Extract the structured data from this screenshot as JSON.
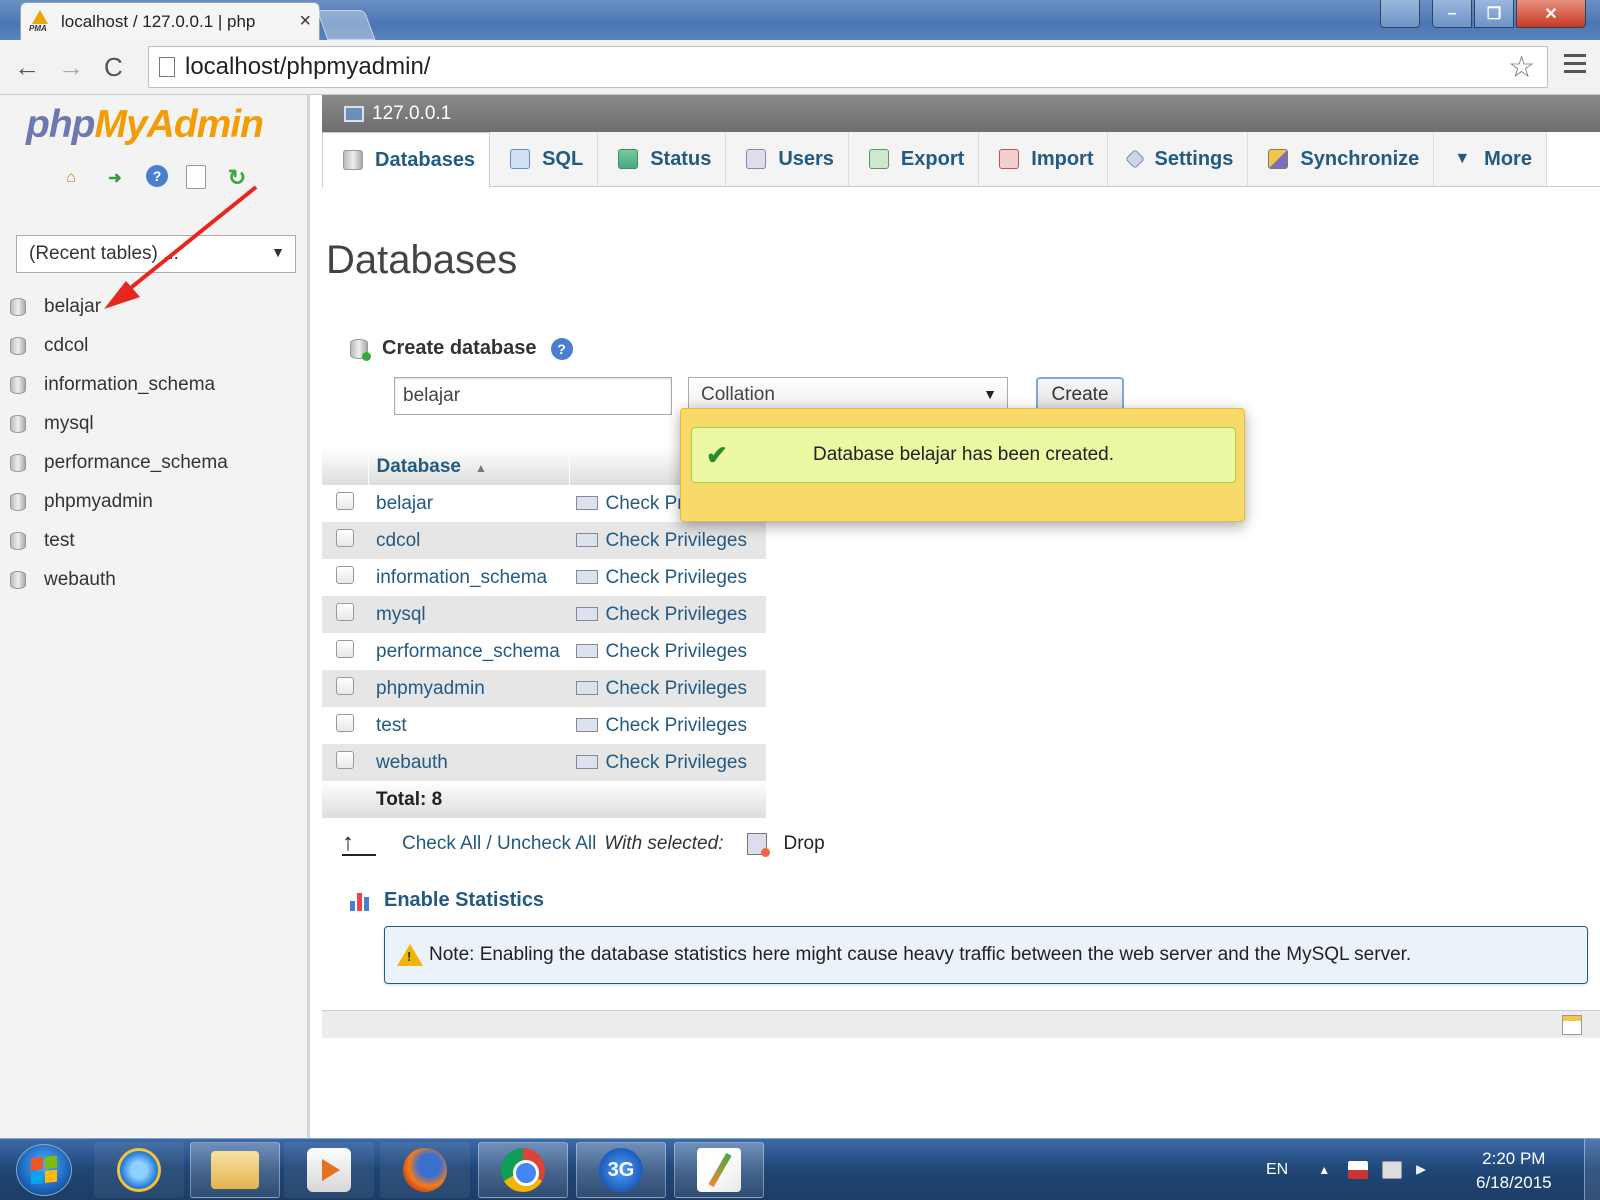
{
  "browser": {
    "tab_title": "localhost / 127.0.0.1 | php",
    "tab_close": "×",
    "url": "localhost/phpmyadmin/",
    "nav_back": "←",
    "nav_forward": "→",
    "nav_reload": "C",
    "bookmark_star": "☆"
  },
  "sidebar": {
    "logo_php": "php",
    "logo_my": "My",
    "logo_admin": "Admin",
    "recent_tables": "(Recent tables) ...",
    "databases": [
      {
        "label": "belajar"
      },
      {
        "label": "cdcol"
      },
      {
        "label": "information_schema"
      },
      {
        "label": "mysql"
      },
      {
        "label": "performance_schema"
      },
      {
        "label": "phpmyadmin"
      },
      {
        "label": "test"
      },
      {
        "label": "webauth"
      }
    ]
  },
  "server": {
    "label": "127.0.0.1"
  },
  "tabs": [
    {
      "label": "Databases",
      "icon": "database-icon"
    },
    {
      "label": "SQL",
      "icon": "sql-icon"
    },
    {
      "label": "Status",
      "icon": "status-icon"
    },
    {
      "label": "Users",
      "icon": "users-icon"
    },
    {
      "label": "Export",
      "icon": "export-icon"
    },
    {
      "label": "Import",
      "icon": "import-icon"
    },
    {
      "label": "Settings",
      "icon": "settings-icon"
    },
    {
      "label": "Synchronize",
      "icon": "synchronize-icon"
    },
    {
      "label": "More",
      "icon": "caret-down-icon"
    }
  ],
  "main": {
    "title": "Databases",
    "create": {
      "label": "Create database",
      "name_value": "belajar",
      "collation_label": "Collation",
      "button_label": "Create"
    },
    "table": {
      "header_database": "Database",
      "rows": [
        {
          "name": "belajar",
          "action": "Check Privileges"
        },
        {
          "name": "cdcol",
          "action": "Check Privileges"
        },
        {
          "name": "information_schema",
          "action": "Check Privileges"
        },
        {
          "name": "mysql",
          "action": "Check Privileges"
        },
        {
          "name": "performance_schema",
          "action": "Check Privileges"
        },
        {
          "name": "phpmyadmin",
          "action": "Check Privileges"
        },
        {
          "name": "test",
          "action": "Check Privileges"
        },
        {
          "name": "webauth",
          "action": "Check Privileges"
        }
      ],
      "total": "Total: 8"
    },
    "popup_message": "Database belajar has been created.",
    "bulk": {
      "check_all": "Check All / Uncheck All",
      "with_selected": "With selected:",
      "drop": "Drop"
    },
    "enable_statistics": "Enable Statistics",
    "note": "Note: Enabling the database statistics here might cause heavy traffic between the web server and the MySQL server."
  },
  "taskbar": {
    "lang": "EN",
    "time": "2:20 PM",
    "date": "6/18/2015",
    "app_3g_label": "3G"
  },
  "colors": {
    "link": "#235a81",
    "logo_orange": "#f29d06",
    "logo_blue": "#6c78af",
    "popup_bg": "#f7da6a",
    "success_bg": "#ebf8a4"
  }
}
